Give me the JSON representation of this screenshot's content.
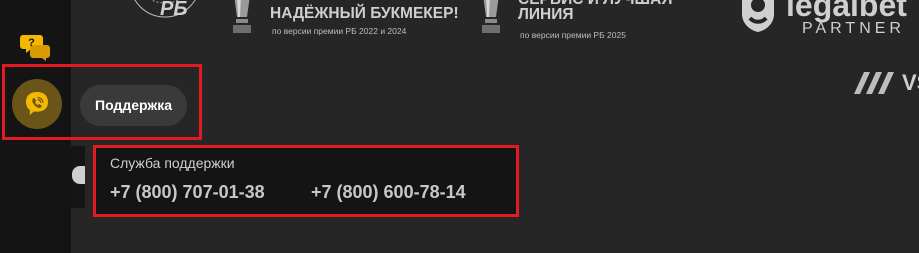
{
  "rail": {
    "chat_label": "?"
  },
  "tooltip": {
    "label": "Поддержка"
  },
  "support_panel": {
    "title": "Служба поддержки",
    "phones": [
      "+7 (800) 707-01-38",
      "+7 (800) 600-78-14"
    ]
  },
  "awards": [
    {
      "title": "РБ",
      "subtitle": ""
    },
    {
      "title": "НАДЁЖНЫЙ БУКМЕКЕР!",
      "subtitle": "по версии премии РБ 2022 и 2024"
    },
    {
      "title": "СЕРВИС И ЛУЧШАЯ\nЛИНИЯ",
      "subtitle": "по версии премии РБ 2025"
    }
  ],
  "partners": {
    "legal_word": "legalbet",
    "partner_word": "PARTNER",
    "vs_word": "VS"
  },
  "colors": {
    "accent": "#f5b800",
    "highlight": "#e01b24",
    "rail": "#141414",
    "page": "#262626"
  }
}
